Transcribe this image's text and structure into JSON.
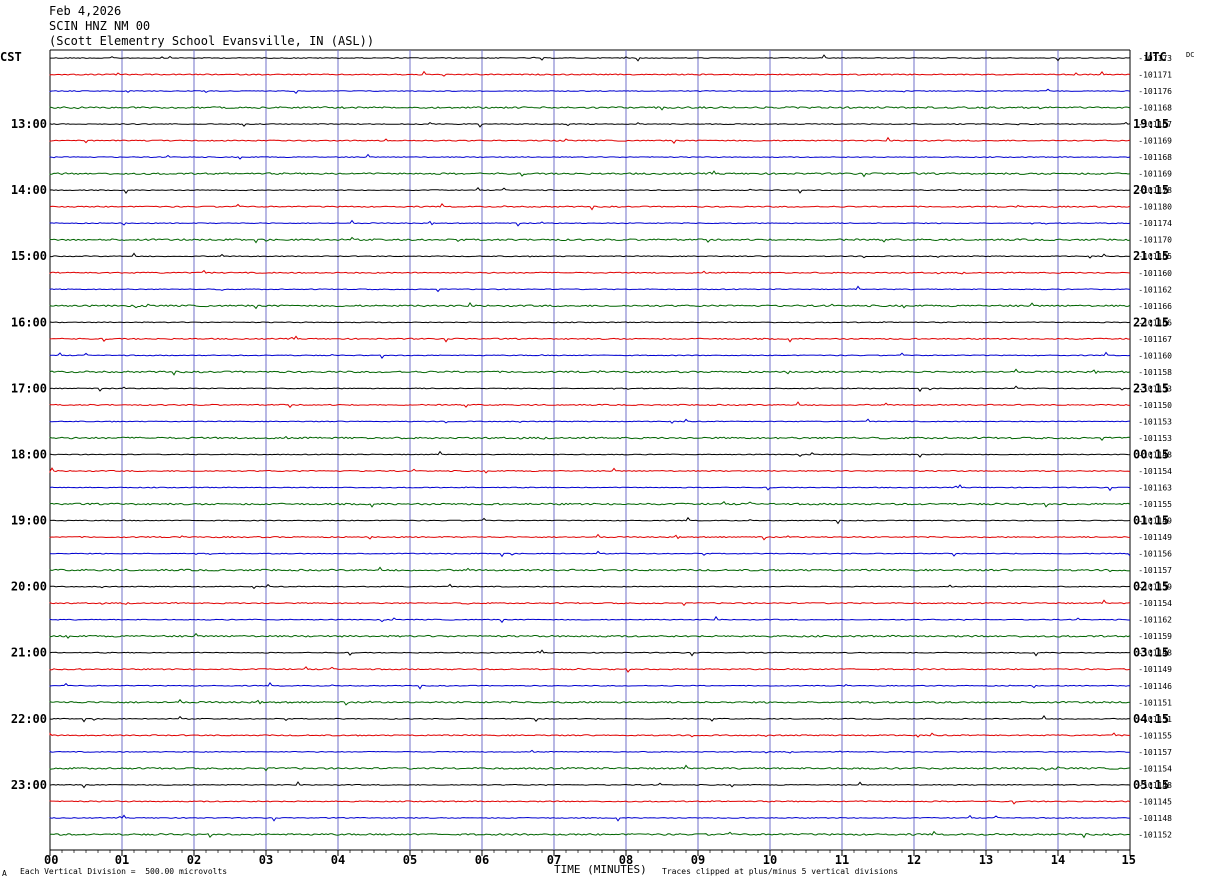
{
  "header": {
    "date": "Feb 4,2026",
    "station": "SCIN HNZ NM 00",
    "location": "(Scott Elementry School Evansville, IN (ASL))"
  },
  "left_axis_label": "CST",
  "right_axis_label": "UTC",
  "dc_label": "DC",
  "footer": {
    "vertical_division": "Each Vertical Division =  500.00 microvolts",
    "clip_note": "Traces clipped at plus/minus 5 vertical divisions",
    "corner_mark": "A"
  },
  "chart_data": {
    "type": "line",
    "title": "SCIN HNZ NM 00",
    "xlabel": "TIME (MINUTES)",
    "xlim": [
      0,
      15
    ],
    "x_ticks": [
      "00",
      "01",
      "02",
      "03",
      "04",
      "05",
      "06",
      "07",
      "08",
      "09",
      "10",
      "11",
      "12",
      "13",
      "14",
      "15"
    ],
    "grid": true,
    "trace_colors": [
      "#000000",
      "#e00000",
      "#0000d0",
      "#006400"
    ],
    "left_hour_labels": [
      "13:00",
      "14:00",
      "15:00",
      "16:00",
      "17:00",
      "18:00",
      "19:00",
      "20:00",
      "21:00",
      "22:00",
      "23:00"
    ],
    "right_hour_labels": [
      "19:15",
      "20:15",
      "21:15",
      "22:15",
      "23:15",
      "00:15",
      "01:15",
      "02:15",
      "03:15",
      "04:15",
      "05:15"
    ],
    "dc_offsets": [
      "-101173",
      "-101171",
      "-101176",
      "-101168",
      "-101167",
      "-101169",
      "-101168",
      "-101169",
      "-101178",
      "-101180",
      "-101174",
      "-101170",
      "-101165",
      "-101160",
      "-101162",
      "-101166",
      "-101166",
      "-101167",
      "-101160",
      "-101158",
      "-101153",
      "-101150",
      "-101153",
      "-101153",
      "-101148",
      "-101154",
      "-101163",
      "-101155",
      "-101149",
      "-101149",
      "-101156",
      "-101157",
      "-101159",
      "-101154",
      "-101162",
      "-101159",
      "-101148",
      "-101149",
      "-101146",
      "-101151",
      "-101151",
      "-101155",
      "-101157",
      "-101154",
      "-101148",
      "-101145",
      "-101148",
      "-101152"
    ]
  }
}
